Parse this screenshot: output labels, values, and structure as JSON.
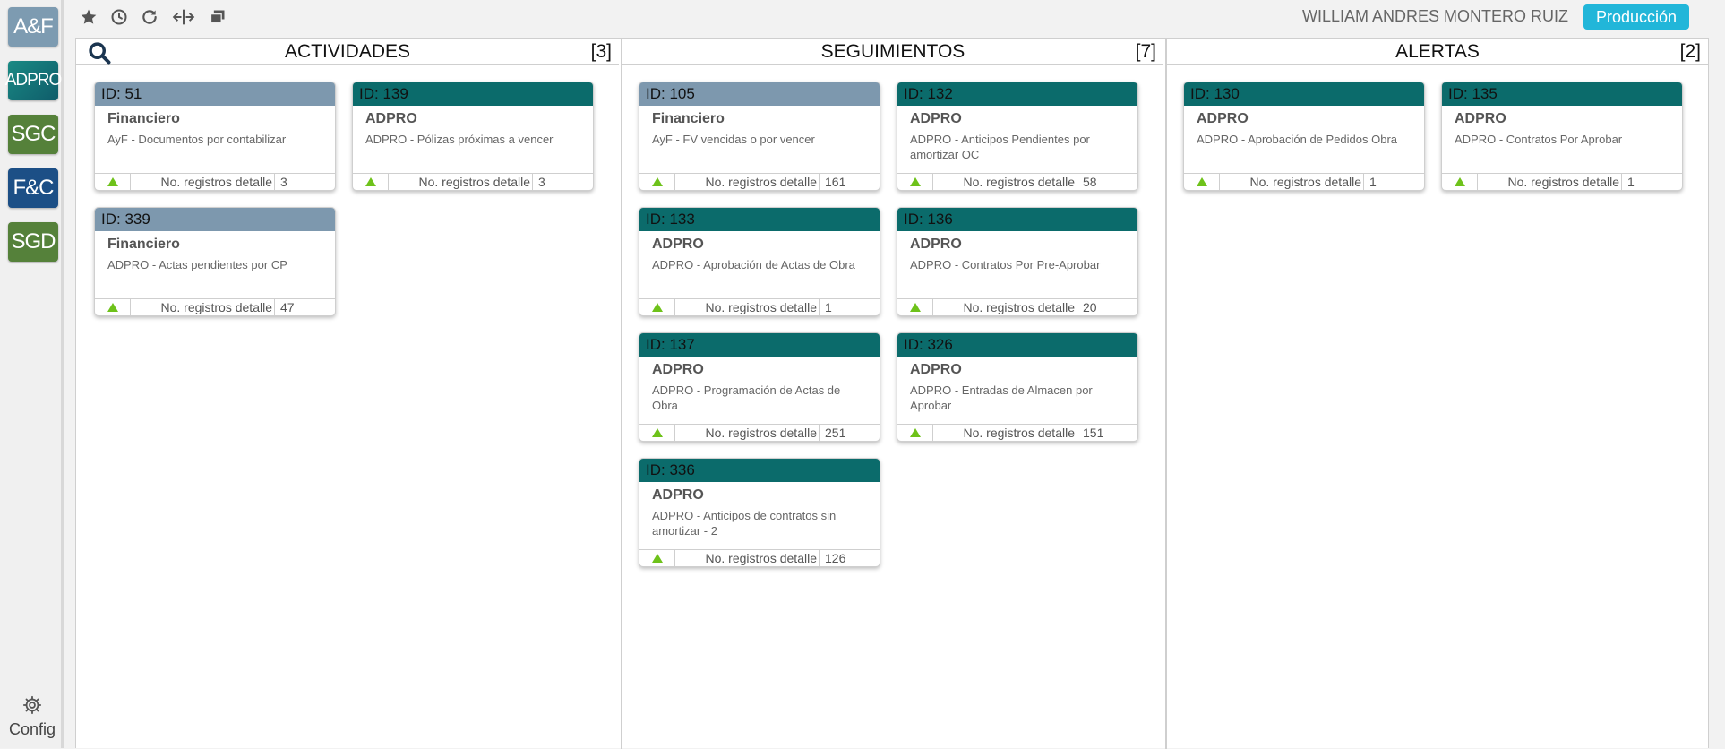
{
  "apps": [
    {
      "label": "A&F",
      "color": "#7d9bb1"
    },
    {
      "label": "ADPRO",
      "color": "#1a7c7a"
    },
    {
      "label": "SGC",
      "color": "#55813a"
    },
    {
      "label": "F&C",
      "color": "#1c4f86"
    },
    {
      "label": "SGD",
      "color": "#55813a"
    }
  ],
  "config_label": "Config",
  "user_name": "WILLIAM ANDRES MONTERO RUIZ",
  "environment": "Producción",
  "colors": {
    "financiero": "#7d98ae",
    "adpro": "#0b6b6b",
    "arrow": "#6ec21a",
    "badge": "#21b6d9"
  },
  "columns": [
    {
      "title": "ACTIVIDADES",
      "count": "[3]",
      "cards": [
        {
          "id": "ID: 51",
          "title": "Financiero",
          "desc": "AyF - Documentos por contabilizar",
          "foot_label": "No. registros detalle",
          "foot_value": "3"
        },
        {
          "id": "ID: 139",
          "title": "ADPRO",
          "desc": "ADPRO - Pólizas próximas a vencer",
          "foot_label": "No. registros detalle",
          "foot_value": "3"
        },
        {
          "id": "ID: 339",
          "title": "Financiero",
          "desc": "ADPRO - Actas pendientes por CP",
          "foot_label": "No. registros detalle",
          "foot_value": "47"
        }
      ]
    },
    {
      "title": "SEGUIMIENTOS",
      "count": "[7]",
      "cards": [
        {
          "id": "ID: 105",
          "title": "Financiero",
          "desc": "AyF - FV vencidas o por vencer",
          "foot_label": "No. registros detalle",
          "foot_value": "161"
        },
        {
          "id": "ID: 132",
          "title": "ADPRO",
          "desc": "ADPRO - Anticipos Pendientes por amortizar OC",
          "foot_label": "No. registros detalle",
          "foot_value": "58"
        },
        {
          "id": "ID: 133",
          "title": "ADPRO",
          "desc": "ADPRO - Aprobación de Actas de Obra",
          "foot_label": "No. registros detalle",
          "foot_value": "1"
        },
        {
          "id": "ID: 136",
          "title": "ADPRO",
          "desc": "ADPRO - Contratos Por Pre-Aprobar",
          "foot_label": "No. registros detalle",
          "foot_value": "20"
        },
        {
          "id": "ID: 137",
          "title": "ADPRO",
          "desc": "ADPRO - Programación de Actas de Obra",
          "foot_label": "No. registros detalle",
          "foot_value": "251"
        },
        {
          "id": "ID: 326",
          "title": "ADPRO",
          "desc": "ADPRO - Entradas de Almacen por Aprobar",
          "foot_label": "No. registros detalle",
          "foot_value": "151"
        },
        {
          "id": "ID: 336",
          "title": "ADPRO",
          "desc": "ADPRO - Anticipos de contratos sin amortizar - 2",
          "foot_label": "No. registros detalle",
          "foot_value": "126"
        }
      ]
    },
    {
      "title": "ALERTAS",
      "count": "[2]",
      "cards": [
        {
          "id": "ID: 130",
          "title": "ADPRO",
          "desc": "ADPRO - Aprobación de Pedidos Obra",
          "foot_label": "No. registros detalle",
          "foot_value": "1"
        },
        {
          "id": "ID: 135",
          "title": "ADPRO",
          "desc": "ADPRO - Contratos Por Aprobar",
          "foot_label": "No. registros detalle",
          "foot_value": "1"
        }
      ]
    }
  ]
}
